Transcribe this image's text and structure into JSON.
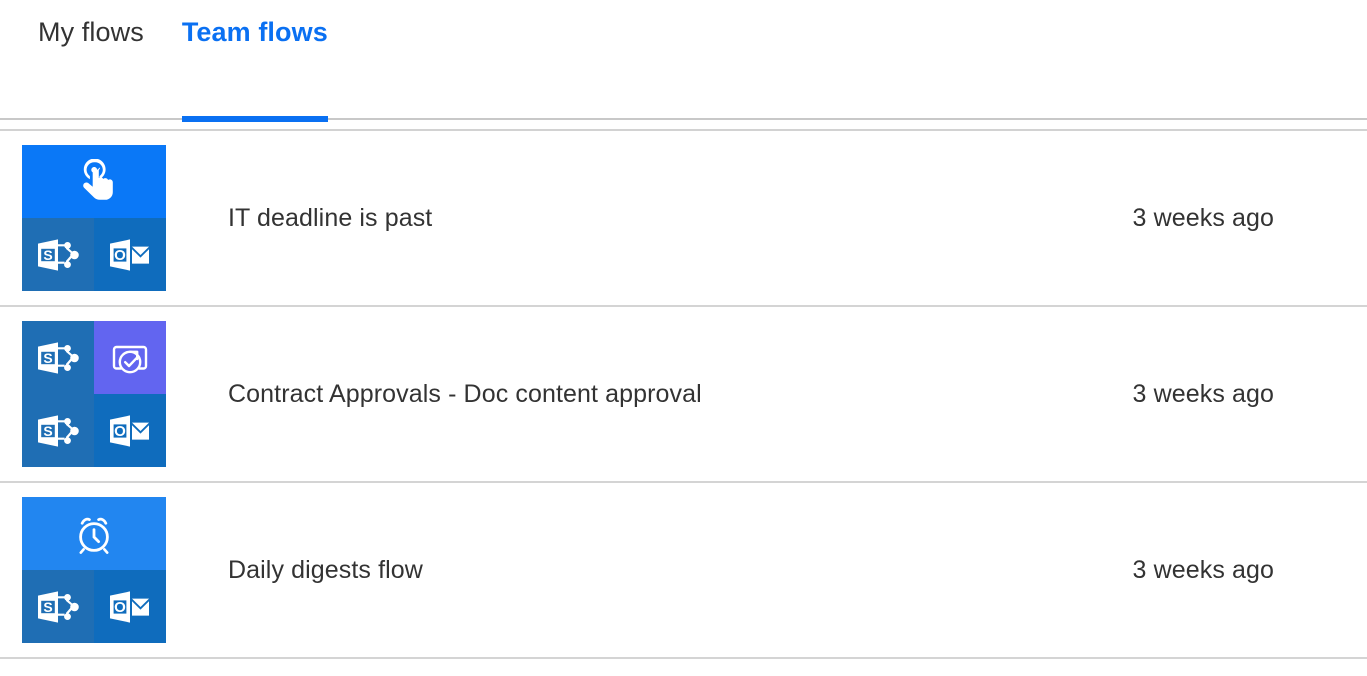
{
  "tabs": [
    {
      "id": "my-flows",
      "label": "My flows",
      "active": false
    },
    {
      "id": "team-flows",
      "label": "Team flows",
      "active": true
    }
  ],
  "colors": {
    "accent": "#0a70f2",
    "trigger_blue": "#0a78f7",
    "schedule_blue": "#2286f0",
    "sharepoint_blue": "#1f6eb4",
    "outlook_blue": "#0f6cbd",
    "approvals_purple": "#6265f0",
    "separator_gray": "#d4d4d4",
    "text": "#333333"
  },
  "flows": [
    {
      "name": "IT deadline is past",
      "modified": "3 weeks ago",
      "tile_layout": "banner",
      "icons": [
        {
          "name": "manual-trigger-icon",
          "kind": "tap",
          "background": "#0a78f7"
        },
        {
          "name": "sharepoint-icon",
          "kind": "sharepoint",
          "background": "#1f6eb4"
        },
        {
          "name": "outlook-icon",
          "kind": "outlook",
          "background": "#0f6cbd"
        }
      ]
    },
    {
      "name": "Contract Approvals - Doc content approval",
      "modified": "3 weeks ago",
      "tile_layout": "quad",
      "icons": [
        {
          "name": "sharepoint-icon",
          "kind": "sharepoint",
          "background": "#1f6eb4"
        },
        {
          "name": "approvals-icon",
          "kind": "approvals",
          "background": "#6265f0"
        },
        {
          "name": "sharepoint-icon",
          "kind": "sharepoint",
          "background": "#1f6eb4"
        },
        {
          "name": "outlook-icon",
          "kind": "outlook",
          "background": "#0f6cbd"
        }
      ]
    },
    {
      "name": "Daily digests flow",
      "modified": "3 weeks ago",
      "tile_layout": "banner",
      "icons": [
        {
          "name": "recurrence-clock-icon",
          "kind": "clock",
          "background": "#2286f0"
        },
        {
          "name": "sharepoint-icon",
          "kind": "sharepoint",
          "background": "#1f6eb4"
        },
        {
          "name": "outlook-icon",
          "kind": "outlook",
          "background": "#0f6cbd"
        }
      ]
    }
  ]
}
